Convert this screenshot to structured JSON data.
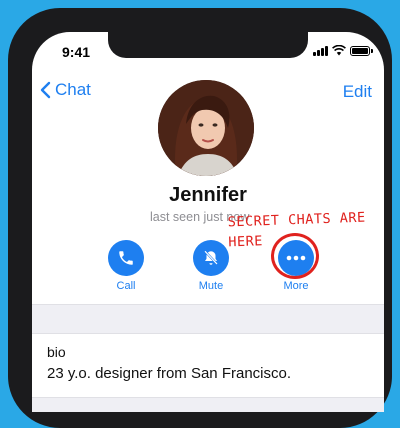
{
  "status_bar": {
    "time": "9:41",
    "icons": [
      "signal-icon",
      "wifi-icon",
      "battery-icon"
    ]
  },
  "nav": {
    "back_label": "Chat",
    "edit_label": "Edit"
  },
  "profile": {
    "name": "Jennifer",
    "last_seen": "last seen just now"
  },
  "actions": [
    {
      "label": "Call",
      "icon": "phone-icon"
    },
    {
      "label": "Mute",
      "icon": "bell-slash-icon"
    },
    {
      "label": "More",
      "icon": "ellipsis-icon"
    }
  ],
  "annotation": {
    "line1": "SECRET CHATS ARE",
    "line2": "HERE"
  },
  "bio": {
    "label": "bio",
    "text": "23 y.o. designer from San Francisco."
  },
  "colors": {
    "accent": "#1e7ff0",
    "annotation": "#e0221e",
    "background": "#2aa8e6"
  }
}
